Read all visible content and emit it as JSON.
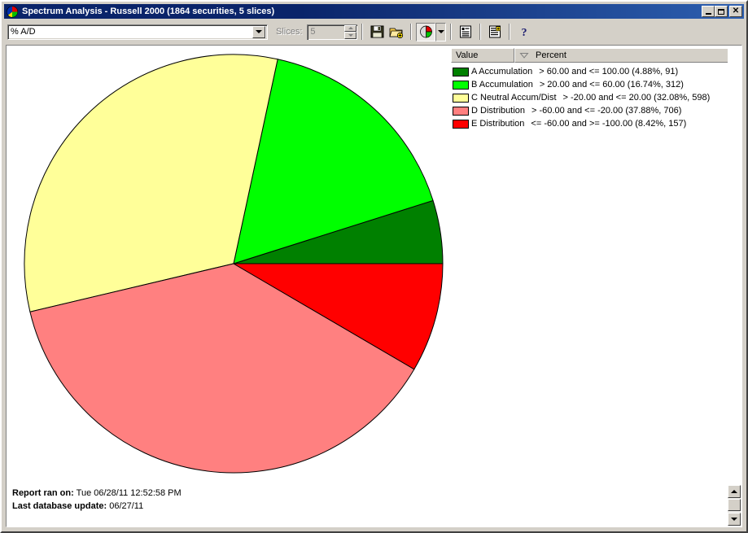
{
  "window": {
    "title": "Spectrum Analysis - Russell 2000 (1864 securities, 5 slices)",
    "app_icon": "pie-chart-icon",
    "minimize_label": "",
    "maximize_label": "",
    "close_label": "✕"
  },
  "toolbar": {
    "indicator_combo_value": "% A/D",
    "slices_label": "Slices:",
    "slices_value": "5",
    "buttons": [
      {
        "name": "save-icon",
        "label": "Save"
      },
      {
        "name": "open-folder-add-icon",
        "label": "Open"
      },
      {
        "name": "pie-chart-icon",
        "label": "Pie Chart"
      },
      {
        "name": "chevron-down-icon",
        "label": "Chart Type"
      },
      {
        "name": "report-list-icon",
        "label": "Report"
      },
      {
        "name": "report-add-icon",
        "label": "New Report"
      },
      {
        "name": "help-icon",
        "label": "Help"
      }
    ]
  },
  "legend": {
    "columns": [
      "Value",
      "Percent"
    ],
    "sort_column": "Percent",
    "sort_direction": "descending",
    "rows": [
      {
        "color": "#008000",
        "name": "A Accumulation",
        "range": "> 60.00 and <= 100.00 (4.88%, 91)"
      },
      {
        "color": "#00FF00",
        "name": "B Accumulation",
        "range": "> 20.00 and <= 60.00 (16.74%, 312)"
      },
      {
        "color": "#FFFF99",
        "name": "C Neutral Accum/Dist",
        "range": "> -20.00 and <= 20.00 (32.08%, 598)"
      },
      {
        "color": "#FF8080",
        "name": "D Distribution",
        "range": "> -60.00 and <= -20.00 (37.88%, 706)"
      },
      {
        "color": "#FF0000",
        "name": "E Distribution",
        "range": "<= -60.00 and >= -100.00 (8.42%, 157)"
      }
    ]
  },
  "footer": {
    "report_ran_label": "Report ran on:",
    "report_ran_value": "Tue 06/28/11 12:52:58 PM",
    "last_update_label": "Last database update:",
    "last_update_value": "06/27/11"
  },
  "chart_data": {
    "type": "pie",
    "title": "Spectrum Analysis - Russell 2000",
    "start_angle_deg": 0,
    "direction": "counterclockwise",
    "center": [
      278,
      327
    ],
    "radius": 257,
    "total_securities": 1864,
    "slice_count": 5,
    "categories": [
      "A Accumulation",
      "B Accumulation",
      "C Neutral Accum/Dist",
      "D Distribution",
      "E Distribution"
    ],
    "values": [
      4.88,
      16.74,
      32.08,
      37.88,
      8.42
    ],
    "counts": [
      91,
      312,
      598,
      706,
      157
    ],
    "colors": [
      "#008000",
      "#00FF00",
      "#FFFF99",
      "#FF8080",
      "#FF0000"
    ],
    "ranges": [
      "> 60.00 and <= 100.00",
      "> 20.00 and <= 60.00",
      "> -20.00 and <= 20.00",
      "> -60.00 and <= -20.00",
      "<= -60.00 and >= -100.00"
    ],
    "ylabel": "Percent",
    "xlabel": "Value",
    "legend_position": "right"
  }
}
